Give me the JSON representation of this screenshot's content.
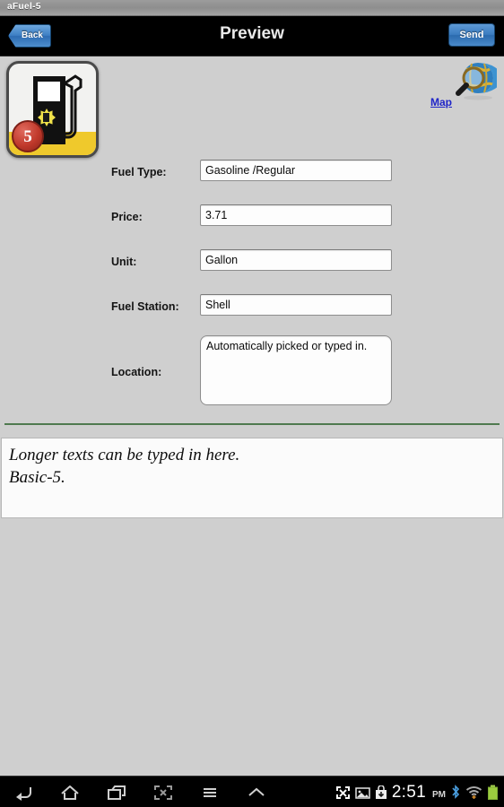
{
  "system": {
    "window_title": "aFuel-5",
    "clock_time": "2:51",
    "clock_period": "PM",
    "nav": [
      {
        "name": "back",
        "icon": "back-arrow-icon"
      },
      {
        "name": "home",
        "icon": "home-icon"
      },
      {
        "name": "recents",
        "icon": "recent-apps-icon"
      },
      {
        "name": "screenshot",
        "icon": "screen-capture-icon"
      },
      {
        "name": "menu",
        "icon": "menu-icon"
      },
      {
        "name": "expand",
        "icon": "chevron-up-icon"
      }
    ],
    "status_icons": [
      {
        "name": "fullscreen-icon"
      },
      {
        "name": "screenshot-saved-icon"
      },
      {
        "name": "download-icon"
      },
      {
        "name": "bluetooth-icon"
      },
      {
        "name": "wifi-icon"
      },
      {
        "name": "battery-icon"
      }
    ]
  },
  "header": {
    "title": "Preview",
    "back_label": "Back",
    "send_label": "Send"
  },
  "app_icon": {
    "badge_number": "5",
    "alt": "fuel-pump-app-icon"
  },
  "map": {
    "link_label": "Map",
    "icon": "globe-search-icon"
  },
  "form": {
    "fields": [
      {
        "label": "Fuel Type:",
        "value": "Gasoline /Regular",
        "name": "fuel-type"
      },
      {
        "label": "Price:",
        "value": "3.71",
        "name": "price"
      },
      {
        "label": "Unit:",
        "value": "Gallon",
        "name": "unit"
      },
      {
        "label": "Fuel Station:",
        "value": "Shell",
        "name": "fuel-station"
      }
    ],
    "location": {
      "label": "Location:",
      "value": "Automatically picked or typed in."
    }
  },
  "notes": {
    "text": "Longer texts can be typed in here.\nBasic-5."
  },
  "colors": {
    "accent_blue": "#3b7cc0",
    "link_blue": "#1f24c8",
    "divider_green": "#4f7a4f",
    "badge_red": "#c0392b",
    "icon_yellow": "#efc92c",
    "page_bg": "#cfcfcf"
  }
}
